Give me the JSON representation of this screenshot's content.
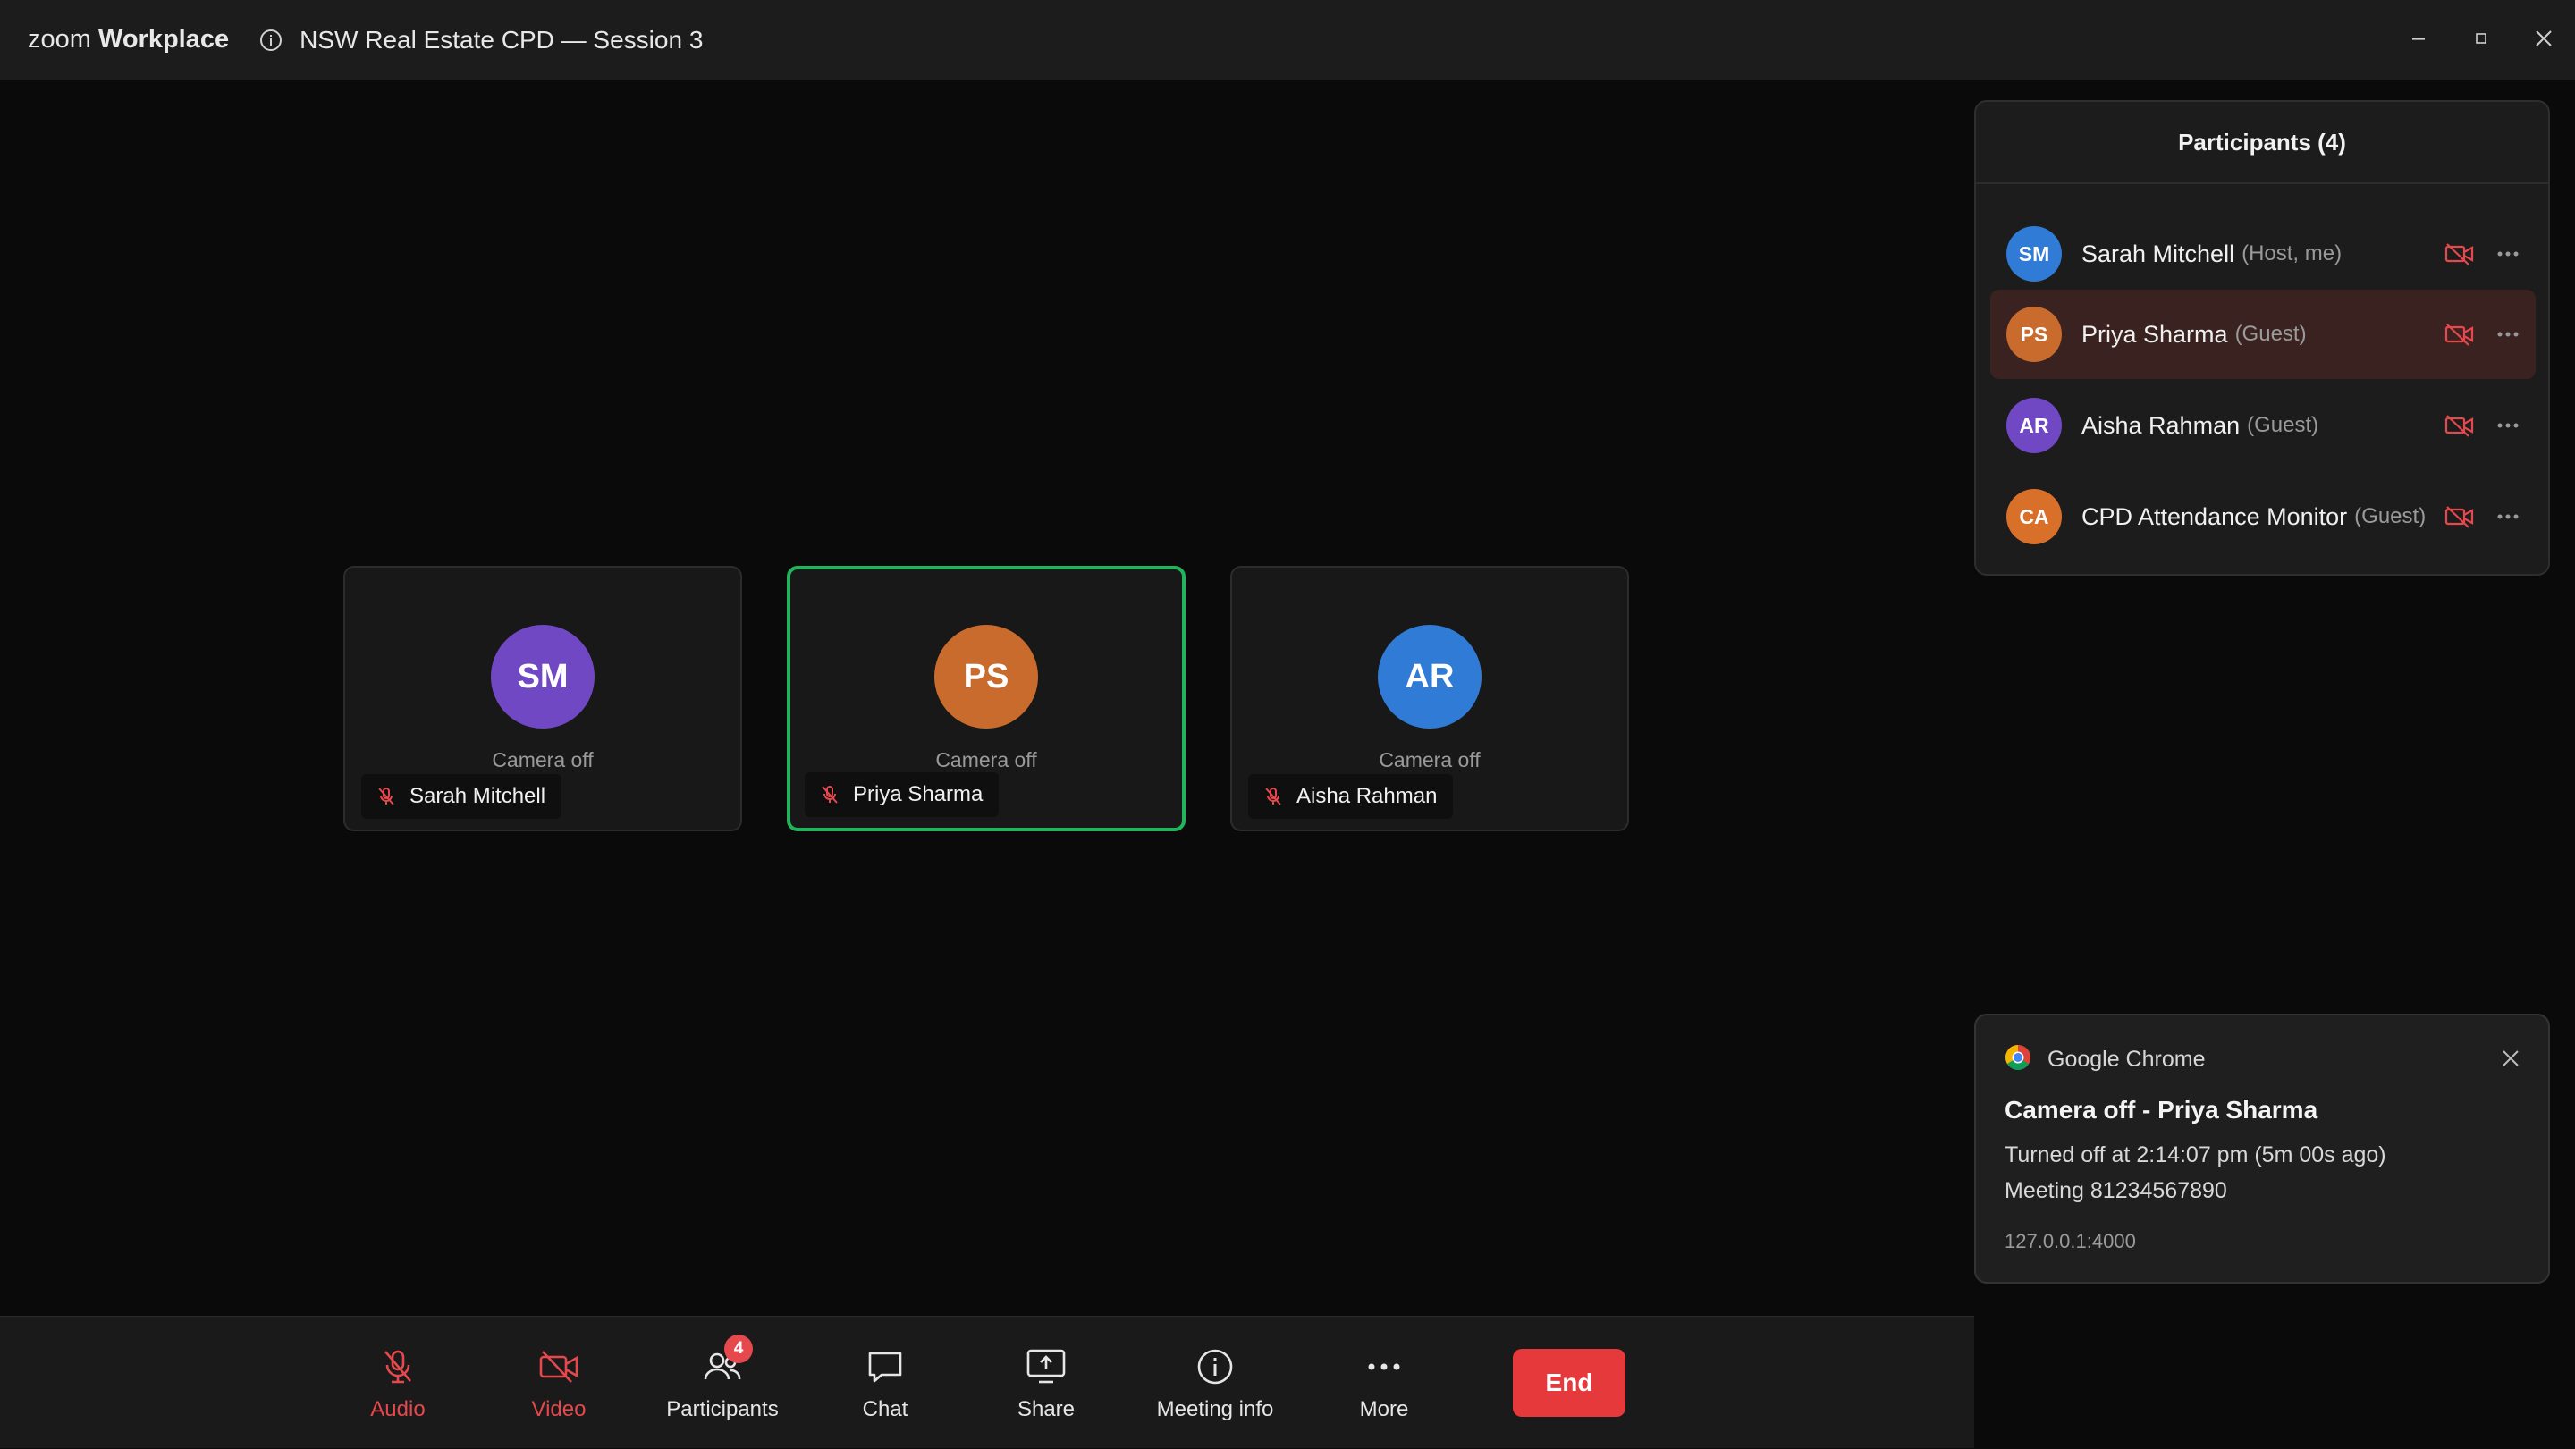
{
  "titlebar": {
    "brand_light": "zoom",
    "brand_bold": "Workplace",
    "meeting_title": "NSW Real Estate CPD — Session 3"
  },
  "tiles": [
    {
      "initials": "SM",
      "status": "Camera off",
      "name": "Sarah Mitchell",
      "color": "#7048c4"
    },
    {
      "initials": "PS",
      "status": "Camera off",
      "name": "Priya Sharma",
      "color": "#c96b2c"
    },
    {
      "initials": "AR",
      "status": "Camera off",
      "name": "Aisha Rahman",
      "color": "#2f7bd6"
    }
  ],
  "participants": {
    "title": "Participants (4)",
    "rows": [
      {
        "initials": "SM",
        "name": "Sarah Mitchell",
        "role": "(Host, me)",
        "color": "#2f7bd6"
      },
      {
        "initials": "PS",
        "name": "Priya Sharma",
        "role": "(Guest)",
        "color": "#c96b2c"
      },
      {
        "initials": "AR",
        "name": "Aisha Rahman",
        "role": "(Guest)",
        "color": "#7048c4"
      },
      {
        "initials": "CA",
        "name": "CPD Attendance Monitor",
        "role": "(Guest)",
        "color": "#d9702a"
      }
    ]
  },
  "notification": {
    "app": "Google Chrome",
    "title": "Camera off - Priya Sharma",
    "line1": "Turned off at 2:14:07 pm (5m 00s ago)",
    "line2": "Meeting 81234567890",
    "source": "127.0.0.1:4000"
  },
  "toolbar": {
    "audio": "Audio",
    "video": "Video",
    "participants": "Participants",
    "participants_badge": "4",
    "chat": "Chat",
    "share": "Share",
    "meeting_info": "Meeting info",
    "more": "More",
    "end": "End"
  },
  "colors": {
    "accent_red": "#e5484d",
    "active_green": "#22b35e"
  }
}
